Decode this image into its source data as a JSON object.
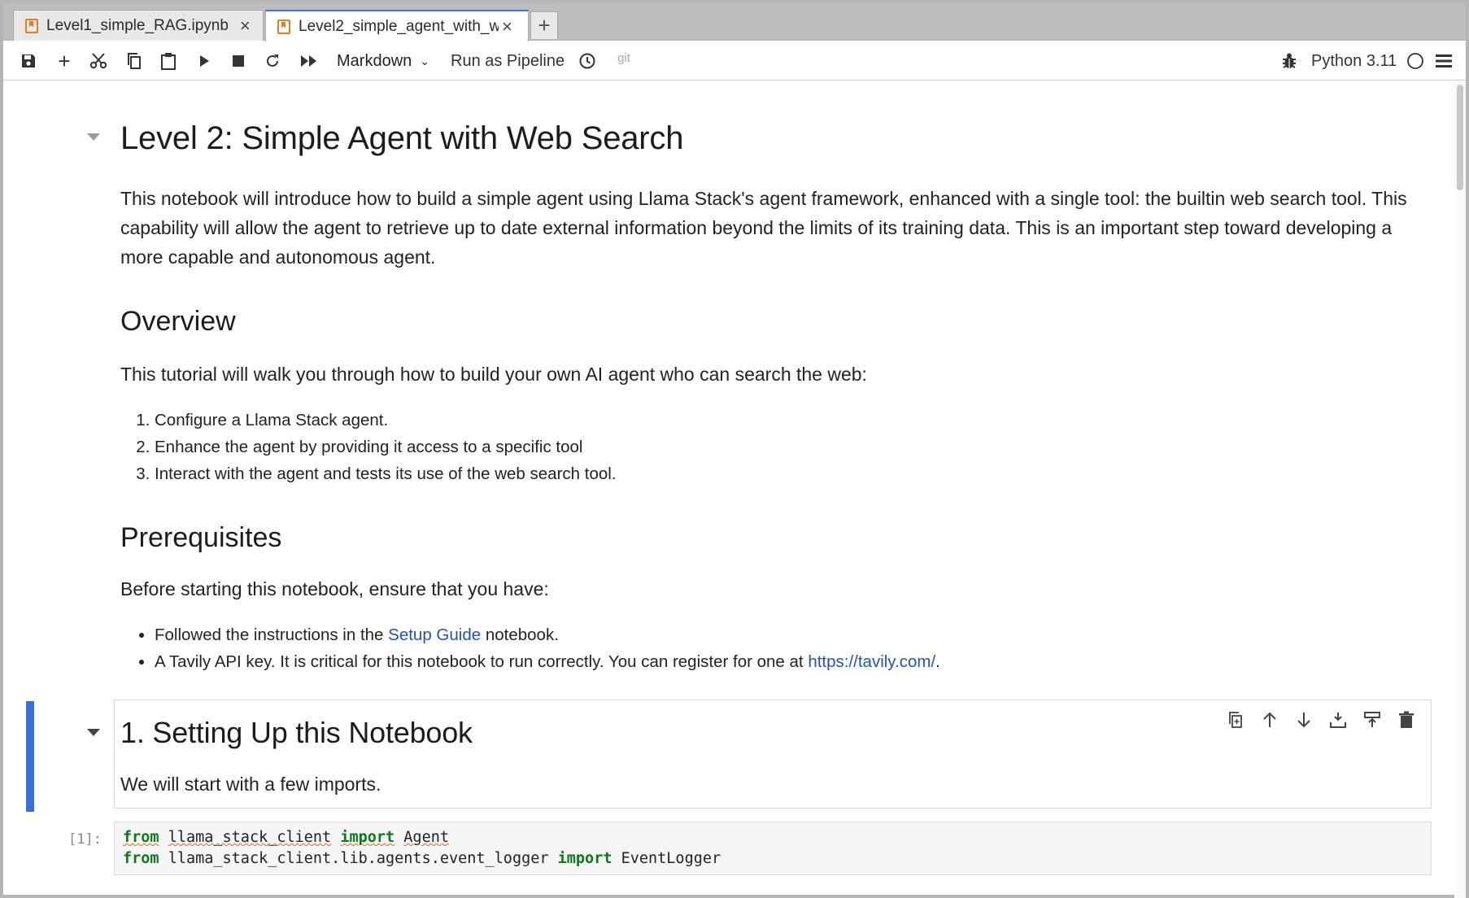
{
  "tabs": [
    {
      "label": "Level1_simple_RAG.ipynb",
      "active": false
    },
    {
      "label": "Level2_simple_agent_with_w",
      "active": true
    }
  ],
  "toolbar": {
    "cell_type": "Markdown",
    "run_as_pipeline": "Run as Pipeline",
    "git": "git",
    "kernel": "Python 3.11"
  },
  "notebook": {
    "title": "Level 2: Simple Agent with Web Search",
    "intro": "This notebook will introduce how to build a simple agent using Llama Stack's agent framework, enhanced with a single tool: the builtin web search tool. This capability will allow the agent to retrieve up to date external information beyond the limits of its training data. This is an important step toward developing a more capable and autonomous agent.",
    "overview_heading": "Overview",
    "overview_text": "This tutorial will walk you through how to build your own AI agent who can search the web:",
    "steps": [
      "Configure a Llama Stack agent.",
      "Enhance the agent by providing it access to a specific tool",
      "Interact with the agent and tests its use of the web search tool."
    ],
    "prereq_heading": "Prerequisites",
    "prereq_text": "Before starting this notebook, ensure that you have:",
    "prereq_1_before": "Followed the instructions in the ",
    "prereq_1_link": "Setup Guide",
    "prereq_1_after": " notebook.",
    "prereq_2_before": "A Tavily API key. It is critical for this notebook to run correctly. You can register for one at ",
    "prereq_2_link": "https://tavily.com/",
    "prereq_2_after": ".",
    "setup_heading": "1. Setting Up this Notebook",
    "setup_text": "We will start with a few imports.",
    "code_prompt": "[1]:",
    "code": {
      "line1_kw1": "from",
      "line1_mod": "llama_stack_client",
      "line1_kw2": "import",
      "line1_name": "Agent",
      "line2_kw1": "from",
      "line2_mod": "llama_stack_client.lib.agents.event_logger",
      "line2_kw2": "import",
      "line2_name": "EventLogger"
    }
  },
  "colors": {
    "accent": "#3a6fd8",
    "link": "#2452b0",
    "keyword": "#0b7a1e",
    "notebook_icon": "#e07b27"
  }
}
